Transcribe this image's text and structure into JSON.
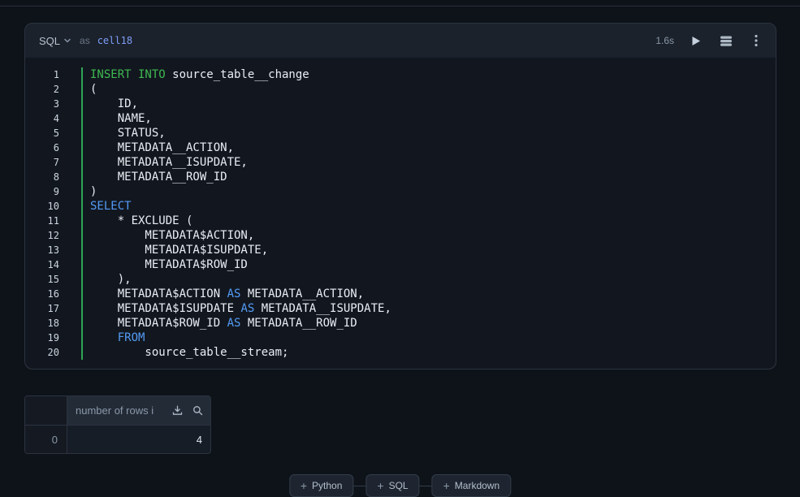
{
  "colors": {
    "accent_green": "#2ea454",
    "keyword_green": "#3fb950",
    "keyword_blue": "#539bf5",
    "cell_name": "#7e9ef7"
  },
  "cell": {
    "language": "SQL",
    "as_label": "as",
    "name": "cell18",
    "duration": "1.6s",
    "code_lines": [
      {
        "n": "1",
        "seg": [
          {
            "t": "INSERT INTO",
            "c": "g"
          },
          {
            "t": " source_table__change"
          }
        ]
      },
      {
        "n": "2",
        "seg": [
          {
            "t": "("
          }
        ]
      },
      {
        "n": "3",
        "seg": [
          {
            "t": "    ID,"
          }
        ]
      },
      {
        "n": "4",
        "seg": [
          {
            "t": "    NAME,"
          }
        ]
      },
      {
        "n": "5",
        "seg": [
          {
            "t": "    STATUS,"
          }
        ]
      },
      {
        "n": "6",
        "seg": [
          {
            "t": "    METADATA__ACTION,"
          }
        ]
      },
      {
        "n": "7",
        "seg": [
          {
            "t": "    METADATA__ISUPDATE,"
          }
        ]
      },
      {
        "n": "8",
        "seg": [
          {
            "t": "    METADATA__ROW_ID"
          }
        ]
      },
      {
        "n": "9",
        "seg": [
          {
            "t": ")"
          }
        ]
      },
      {
        "n": "10",
        "seg": [
          {
            "t": "SELECT",
            "c": "b"
          }
        ]
      },
      {
        "n": "11",
        "seg": [
          {
            "t": "    * EXCLUDE ("
          }
        ]
      },
      {
        "n": "12",
        "seg": [
          {
            "t": "        METADATA$ACTION,"
          }
        ]
      },
      {
        "n": "13",
        "seg": [
          {
            "t": "        METADATA$ISUPDATE,"
          }
        ]
      },
      {
        "n": "14",
        "seg": [
          {
            "t": "        METADATA$ROW_ID"
          }
        ]
      },
      {
        "n": "15",
        "seg": [
          {
            "t": "    ),"
          }
        ]
      },
      {
        "n": "16",
        "seg": [
          {
            "t": "    METADATA$ACTION "
          },
          {
            "t": "AS",
            "c": "b"
          },
          {
            "t": " METADATA__ACTION,"
          }
        ]
      },
      {
        "n": "17",
        "seg": [
          {
            "t": "    METADATA$ISUPDATE "
          },
          {
            "t": "AS",
            "c": "b"
          },
          {
            "t": " METADATA__ISUPDATE,"
          }
        ]
      },
      {
        "n": "18",
        "seg": [
          {
            "t": "    METADATA$ROW_ID "
          },
          {
            "t": "AS",
            "c": "b"
          },
          {
            "t": " METADATA__ROW_ID"
          }
        ]
      },
      {
        "n": "19",
        "seg": [
          {
            "t": "    "
          },
          {
            "t": "FROM",
            "c": "b"
          }
        ]
      },
      {
        "n": "20",
        "seg": [
          {
            "t": "        source_table__stream;"
          }
        ]
      }
    ]
  },
  "results_table": {
    "value_header": "number of rows i",
    "rows": [
      {
        "index": "0",
        "value": "4"
      }
    ]
  },
  "add_cell_buttons": [
    {
      "label": "Python"
    },
    {
      "label": "SQL"
    },
    {
      "label": "Markdown"
    }
  ]
}
